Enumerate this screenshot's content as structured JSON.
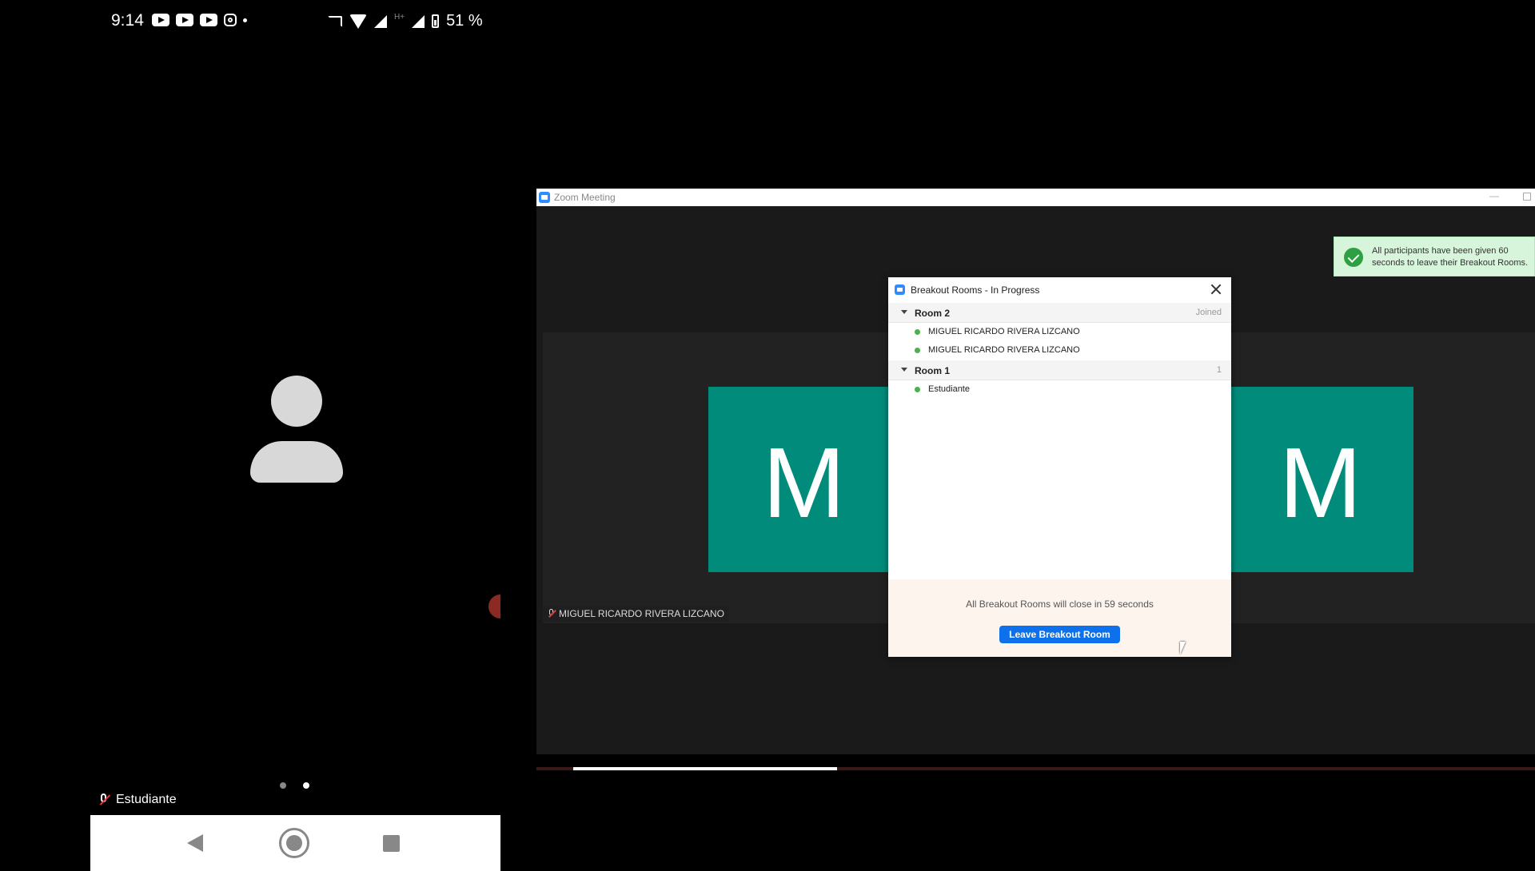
{
  "phone": {
    "status_bar": {
      "time": "9:14",
      "notification_icons": [
        "youtube-icon",
        "youtube-icon",
        "youtube-icon",
        "instagram-icon",
        "more-dot-icon"
      ],
      "system_icons": [
        "cast-icon",
        "wifi-icon",
        "no-signal-icon",
        "signal-icon",
        "battery-icon"
      ],
      "network_type": "H+",
      "battery_percent": "51 %"
    },
    "participant_name": "Estudiante",
    "page_indicator": {
      "count": 2,
      "active_index": 1
    },
    "nav": [
      "back-icon",
      "home-icon",
      "recents-icon"
    ]
  },
  "zoom": {
    "window_title": "Zoom Meeting",
    "toast": {
      "text": "All participants have been given 60 seconds to leave their Breakout Rooms.",
      "color": "#d6f5da"
    },
    "tiles": [
      {
        "letter": "M",
        "color": "#008b7a"
      },
      {
        "letter": "M",
        "color": "#008b7a"
      }
    ],
    "name_tag": "MIGUEL RICARDO RIVERA LIZCANO",
    "breakout": {
      "title": "Breakout Rooms - In Progress",
      "rooms": [
        {
          "name": "Room 2",
          "status": "Joined",
          "members": [
            "MIGUEL RICARDO RIVERA LIZCANO",
            "MIGUEL RICARDO RIVERA LIZCANO"
          ]
        },
        {
          "name": "Room 1",
          "status": "1",
          "members": [
            "Estudiante"
          ]
        }
      ],
      "countdown": "All Breakout Rooms will close in 59 seconds",
      "leave_button": "Leave Breakout Room",
      "accent_color": "#0e71eb"
    }
  }
}
